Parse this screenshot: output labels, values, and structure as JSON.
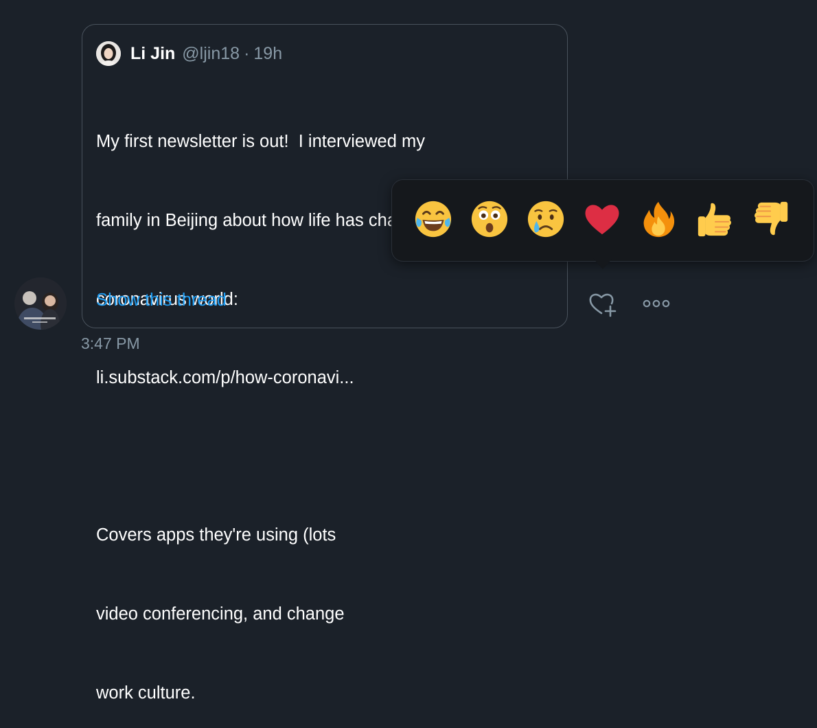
{
  "tweet": {
    "author_name": "Li Jin",
    "author_handle": "@ljin18",
    "separator": "·",
    "age": "19h",
    "text_lines": [
      "My first newsletter is out!  I interviewed my",
      "family in Beijing about how life has changed in a",
      "coronavirus world:",
      "li.substack.com/p/how-coronavi...",
      "",
      "Covers apps they're using (lots",
      "video conferencing, and change",
      "work culture."
    ],
    "show_thread": "Show this thread"
  },
  "timestamp": "3:47 PM",
  "reactions": [
    {
      "name": "laughing-crying-emoji",
      "glyph": "😂"
    },
    {
      "name": "surprised-emoji",
      "glyph": "😲"
    },
    {
      "name": "crying-emoji",
      "glyph": "😢"
    },
    {
      "name": "red-heart-emoji",
      "glyph": "❤️"
    },
    {
      "name": "fire-emoji",
      "glyph": "🔥"
    },
    {
      "name": "thumbs-up-emoji",
      "glyph": "👍"
    },
    {
      "name": "thumbs-down-emoji",
      "glyph": "👎"
    }
  ],
  "actions": {
    "react_icon": "heart-plus-icon",
    "more_icon": "more-dots-icon"
  },
  "colors": {
    "background": "#1b2129",
    "link": "#1d9bf0",
    "muted": "#8899a6",
    "border": "#4a535d"
  }
}
